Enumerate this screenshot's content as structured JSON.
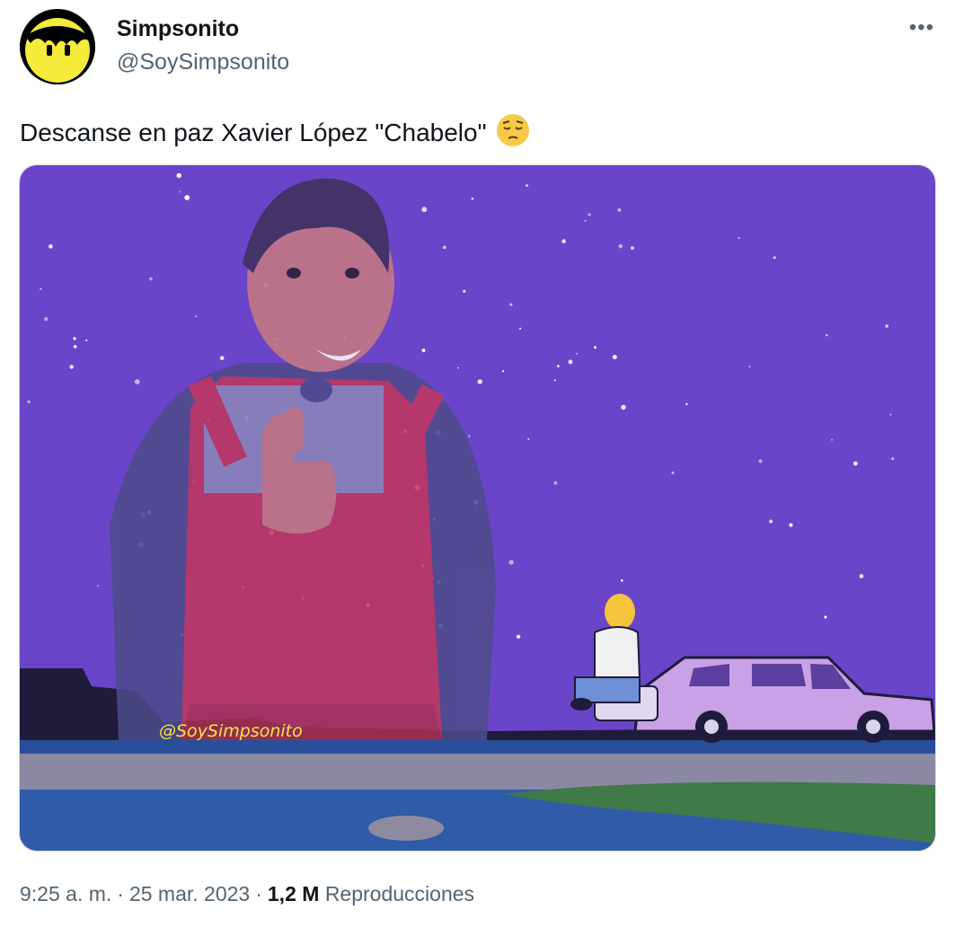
{
  "author": {
    "display_name": "Simpsonito",
    "handle": "@SoySimpsonito"
  },
  "tweet": {
    "text": "Descanse en paz Xavier López \"Chabelo\"",
    "emoji": "pensive-face-icon",
    "media": {
      "watermark": "@SoySimpsonito"
    }
  },
  "meta": {
    "time": "9:25 a. m.",
    "separator": "·",
    "date": "25 mar. 2023",
    "views_count": "1,2 M",
    "views_label": "Reproducciones"
  },
  "colors": {
    "sky": "#6a45c9",
    "secondary_text": "#536471",
    "primary_text": "#0f1419"
  }
}
